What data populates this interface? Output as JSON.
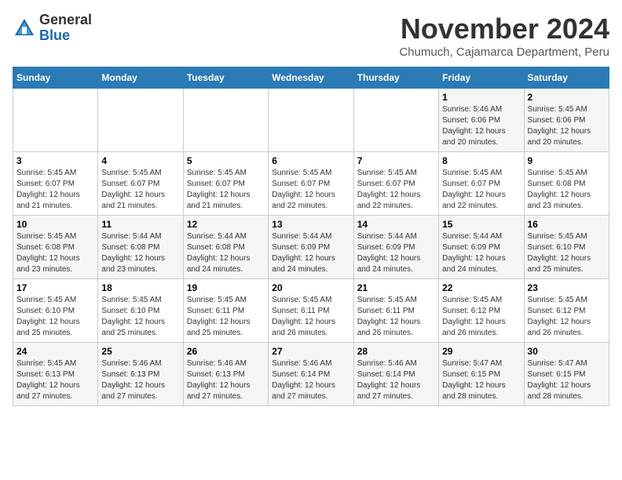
{
  "header": {
    "logo_general": "General",
    "logo_blue": "Blue",
    "month_title": "November 2024",
    "location": "Chumuch, Cajamarca Department, Peru"
  },
  "weekdays": [
    "Sunday",
    "Monday",
    "Tuesday",
    "Wednesday",
    "Thursday",
    "Friday",
    "Saturday"
  ],
  "weeks": [
    [
      {
        "day": "",
        "detail": ""
      },
      {
        "day": "",
        "detail": ""
      },
      {
        "day": "",
        "detail": ""
      },
      {
        "day": "",
        "detail": ""
      },
      {
        "day": "",
        "detail": ""
      },
      {
        "day": "1",
        "detail": "Sunrise: 5:46 AM\nSunset: 6:06 PM\nDaylight: 12 hours and 20 minutes."
      },
      {
        "day": "2",
        "detail": "Sunrise: 5:45 AM\nSunset: 6:06 PM\nDaylight: 12 hours and 20 minutes."
      }
    ],
    [
      {
        "day": "3",
        "detail": "Sunrise: 5:45 AM\nSunset: 6:07 PM\nDaylight: 12 hours and 21 minutes."
      },
      {
        "day": "4",
        "detail": "Sunrise: 5:45 AM\nSunset: 6:07 PM\nDaylight: 12 hours and 21 minutes."
      },
      {
        "day": "5",
        "detail": "Sunrise: 5:45 AM\nSunset: 6:07 PM\nDaylight: 12 hours and 21 minutes."
      },
      {
        "day": "6",
        "detail": "Sunrise: 5:45 AM\nSunset: 6:07 PM\nDaylight: 12 hours and 22 minutes."
      },
      {
        "day": "7",
        "detail": "Sunrise: 5:45 AM\nSunset: 6:07 PM\nDaylight: 12 hours and 22 minutes."
      },
      {
        "day": "8",
        "detail": "Sunrise: 5:45 AM\nSunset: 6:07 PM\nDaylight: 12 hours and 22 minutes."
      },
      {
        "day": "9",
        "detail": "Sunrise: 5:45 AM\nSunset: 6:08 PM\nDaylight: 12 hours and 23 minutes."
      }
    ],
    [
      {
        "day": "10",
        "detail": "Sunrise: 5:45 AM\nSunset: 6:08 PM\nDaylight: 12 hours and 23 minutes."
      },
      {
        "day": "11",
        "detail": "Sunrise: 5:44 AM\nSunset: 6:08 PM\nDaylight: 12 hours and 23 minutes."
      },
      {
        "day": "12",
        "detail": "Sunrise: 5:44 AM\nSunset: 6:08 PM\nDaylight: 12 hours and 24 minutes."
      },
      {
        "day": "13",
        "detail": "Sunrise: 5:44 AM\nSunset: 6:09 PM\nDaylight: 12 hours and 24 minutes."
      },
      {
        "day": "14",
        "detail": "Sunrise: 5:44 AM\nSunset: 6:09 PM\nDaylight: 12 hours and 24 minutes."
      },
      {
        "day": "15",
        "detail": "Sunrise: 5:44 AM\nSunset: 6:09 PM\nDaylight: 12 hours and 24 minutes."
      },
      {
        "day": "16",
        "detail": "Sunrise: 5:45 AM\nSunset: 6:10 PM\nDaylight: 12 hours and 25 minutes."
      }
    ],
    [
      {
        "day": "17",
        "detail": "Sunrise: 5:45 AM\nSunset: 6:10 PM\nDaylight: 12 hours and 25 minutes."
      },
      {
        "day": "18",
        "detail": "Sunrise: 5:45 AM\nSunset: 6:10 PM\nDaylight: 12 hours and 25 minutes."
      },
      {
        "day": "19",
        "detail": "Sunrise: 5:45 AM\nSunset: 6:11 PM\nDaylight: 12 hours and 25 minutes."
      },
      {
        "day": "20",
        "detail": "Sunrise: 5:45 AM\nSunset: 6:11 PM\nDaylight: 12 hours and 26 minutes."
      },
      {
        "day": "21",
        "detail": "Sunrise: 5:45 AM\nSunset: 6:11 PM\nDaylight: 12 hours and 26 minutes."
      },
      {
        "day": "22",
        "detail": "Sunrise: 5:45 AM\nSunset: 6:12 PM\nDaylight: 12 hours and 26 minutes."
      },
      {
        "day": "23",
        "detail": "Sunrise: 5:45 AM\nSunset: 6:12 PM\nDaylight: 12 hours and 26 minutes."
      }
    ],
    [
      {
        "day": "24",
        "detail": "Sunrise: 5:45 AM\nSunset: 6:13 PM\nDaylight: 12 hours and 27 minutes."
      },
      {
        "day": "25",
        "detail": "Sunrise: 5:46 AM\nSunset: 6:13 PM\nDaylight: 12 hours and 27 minutes."
      },
      {
        "day": "26",
        "detail": "Sunrise: 5:46 AM\nSunset: 6:13 PM\nDaylight: 12 hours and 27 minutes."
      },
      {
        "day": "27",
        "detail": "Sunrise: 5:46 AM\nSunset: 6:14 PM\nDaylight: 12 hours and 27 minutes."
      },
      {
        "day": "28",
        "detail": "Sunrise: 5:46 AM\nSunset: 6:14 PM\nDaylight: 12 hours and 27 minutes."
      },
      {
        "day": "29",
        "detail": "Sunrise: 5:47 AM\nSunset: 6:15 PM\nDaylight: 12 hours and 28 minutes."
      },
      {
        "day": "30",
        "detail": "Sunrise: 5:47 AM\nSunset: 6:15 PM\nDaylight: 12 hours and 28 minutes."
      }
    ]
  ]
}
